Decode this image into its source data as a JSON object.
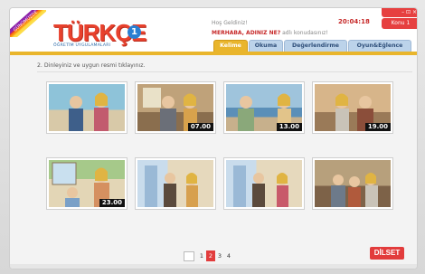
{
  "header": {
    "corner_ribbon": "GÜNÜMÜZDE",
    "logo_word": "TÜRKÇE",
    "logo_subtitle": "ÖĞRETİM UYGULAMALARI",
    "logo_level": "1",
    "greeting": "Hoş Geldiniz!",
    "topic_prefix": "MERHABA, ADINIZ NE?",
    "topic_suffix": " adlı konudasınız!",
    "clock": "20:04:18",
    "window_controls": "– ⊡ ×",
    "topic_button": "Konu 1"
  },
  "tabs": [
    {
      "label": "Kelime",
      "active": true
    },
    {
      "label": "Okuma",
      "active": false
    },
    {
      "label": "Değerlendirme",
      "active": false
    },
    {
      "label": "Oyun&Eğlence",
      "active": false
    }
  ],
  "instruction": "2. Dinleyiniz ve uygun resmi tıklayınız.",
  "thumbnails": [
    {
      "time": ""
    },
    {
      "time": "07.00"
    },
    {
      "time": "13.00"
    },
    {
      "time": "19.00"
    },
    {
      "time": "23.00"
    },
    {
      "time": ""
    },
    {
      "time": ""
    },
    {
      "time": ""
    }
  ],
  "pager": {
    "pages": [
      "1",
      "2",
      "3",
      "4"
    ],
    "current": "2"
  },
  "brand": "DİLSET",
  "colors": {
    "accent": "#e9b52c",
    "red": "#e23c3c",
    "tab": "#bcd3ea"
  }
}
